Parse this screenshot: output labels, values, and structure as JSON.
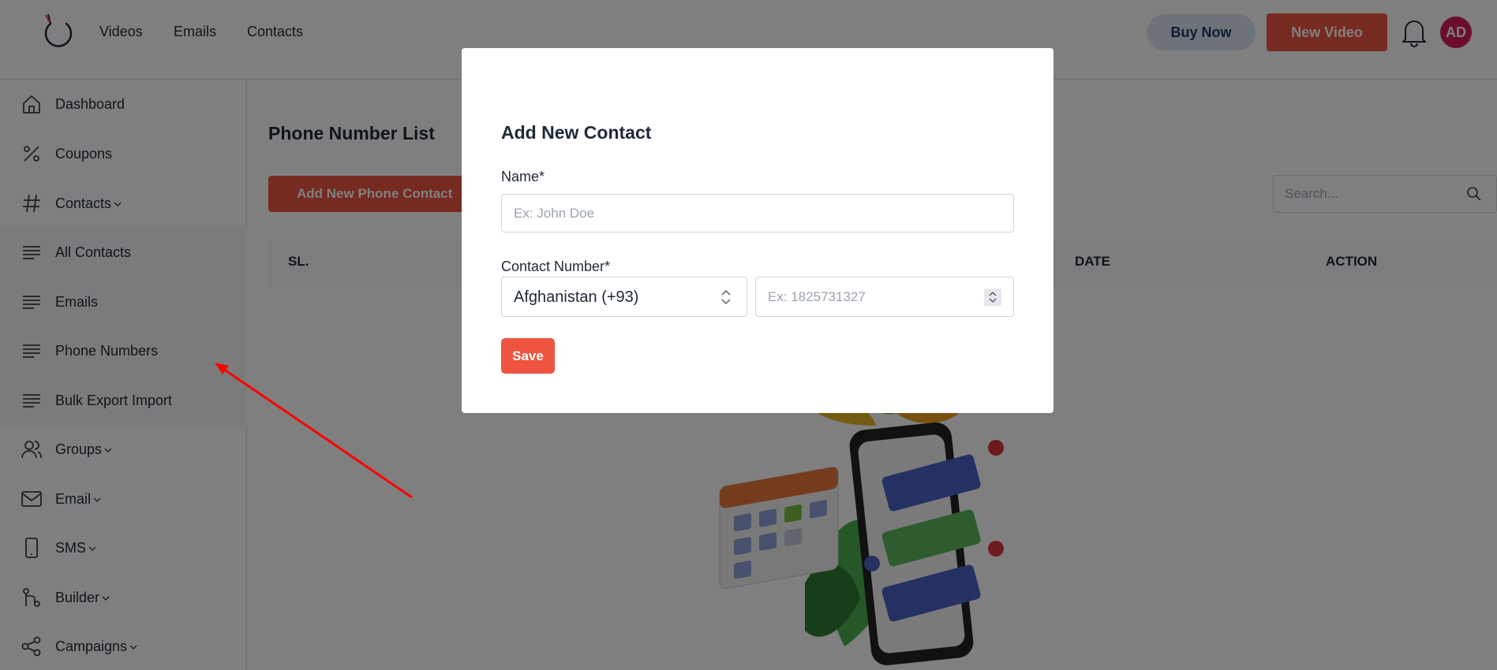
{
  "topbar": {
    "nav": [
      "Videos",
      "Emails",
      "Contacts"
    ],
    "buy_now": "Buy Now",
    "new_video": "New Video",
    "avatar_initials": "AD"
  },
  "sidebar": {
    "items": [
      {
        "label": "Dashboard",
        "icon": "home-icon"
      },
      {
        "label": "Coupons",
        "icon": "percent-icon"
      },
      {
        "label": "Contacts",
        "icon": "hash-icon",
        "has_dropdown": true
      },
      {
        "label": "All Contacts",
        "icon": "lines-icon"
      },
      {
        "label": "Emails",
        "icon": "lines-icon"
      },
      {
        "label": "Phone Numbers",
        "icon": "lines-icon"
      },
      {
        "label": "Bulk Export Import",
        "icon": "lines-icon"
      },
      {
        "label": "Groups",
        "icon": "users-icon",
        "has_dropdown": true
      },
      {
        "label": "Email",
        "icon": "mail-icon",
        "has_dropdown": true
      },
      {
        "label": "SMS",
        "icon": "phone-icon",
        "has_dropdown": true
      },
      {
        "label": "Builder",
        "icon": "builder-icon",
        "has_dropdown": true
      },
      {
        "label": "Campaigns",
        "icon": "share-icon",
        "has_dropdown": true
      }
    ]
  },
  "main": {
    "title": "Phone Number List",
    "add_button": "Add New Phone Contact",
    "search_placeholder": "Search...",
    "columns": [
      "SL.",
      "DATE",
      "ACTION"
    ]
  },
  "modal": {
    "title": "Add New Contact",
    "name_label": "Name*",
    "name_placeholder": "Ex: John Doe",
    "contact_label": "Contact Number*",
    "country_value": "Afghanistan (+93)",
    "phone_placeholder": "Ex: 1825731327",
    "save_label": "Save"
  },
  "colors": {
    "accent": "#ef5440",
    "avatar": "#d81b60",
    "buy_now_bg": "#dbe7f3",
    "annotation_arrow": "#ff0000"
  }
}
